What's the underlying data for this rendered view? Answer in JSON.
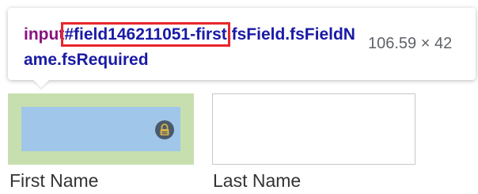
{
  "inspector_tooltip": {
    "tag": "input",
    "id_part": "#field146211051-first",
    "class_part": ".fsField.fsFieldName.fsRequired",
    "dimensions": "106.59 × 42"
  },
  "form": {
    "first_name_label": "First Name",
    "last_name_label": "Last Name",
    "first_name_value": "",
    "last_name_value": ""
  },
  "colors": {
    "padding_highlight": "#c7dfae",
    "content_highlight": "#a0c6e9",
    "id_outline": "#e8262b",
    "tag_color": "#881280",
    "selector_color": "#1a1aa6"
  },
  "icons": {
    "lock": "password-manager-lock-icon"
  }
}
